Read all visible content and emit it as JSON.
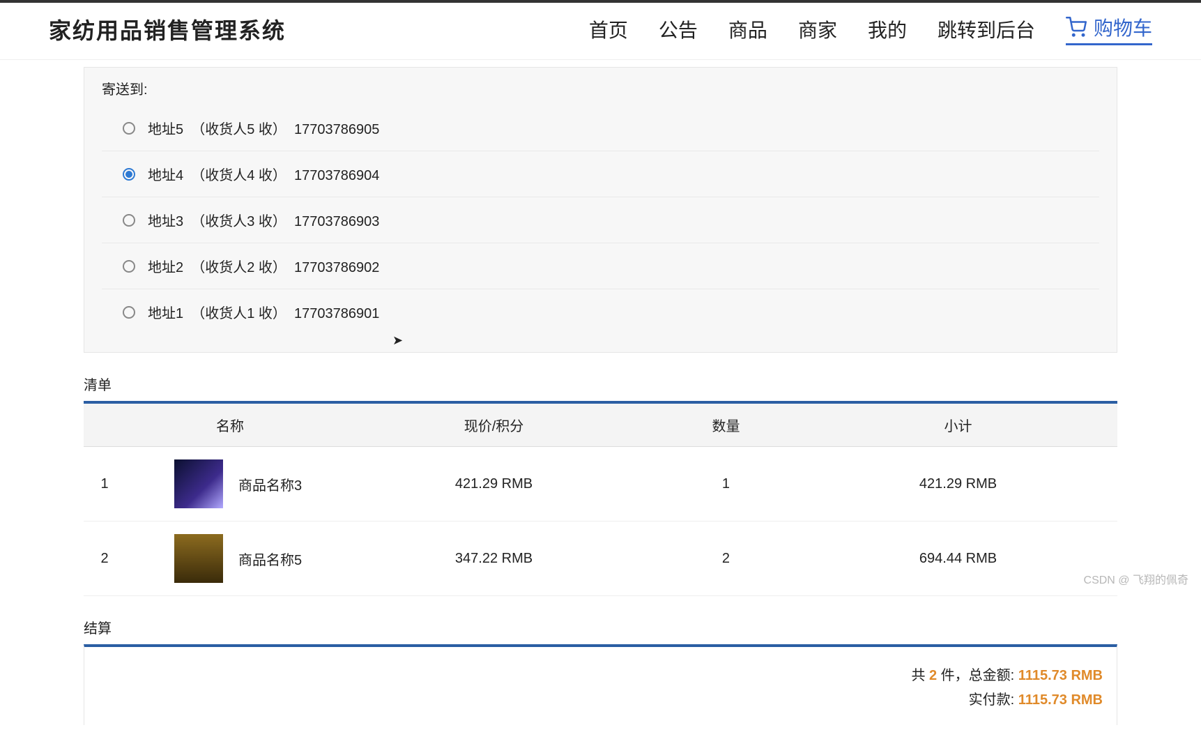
{
  "brand": "家纺用品销售管理系统",
  "nav": {
    "home": "首页",
    "notice": "公告",
    "goods": "商品",
    "merchant": "商家",
    "mine": "我的",
    "admin": "跳转到后台",
    "cart": "购物车"
  },
  "shipping": {
    "title": "寄送到:",
    "selected_index": 1,
    "addresses": [
      {
        "label": "地址5  （收货人5 收）  17703786905"
      },
      {
        "label": "地址4  （收货人4 收）  17703786904"
      },
      {
        "label": "地址3  （收货人3 收）  17703786903"
      },
      {
        "label": "地址2  （收货人2 收）  17703786902"
      },
      {
        "label": "地址1  （收货人1 收）  17703786901"
      }
    ]
  },
  "list": {
    "title": "清单",
    "headers": {
      "name": "名称",
      "price": "现价/积分",
      "qty": "数量",
      "subtotal": "小计"
    },
    "rows": [
      {
        "idx": "1",
        "name": "商品名称3",
        "price": "421.29 RMB",
        "qty": "1",
        "subtotal": "421.29 RMB"
      },
      {
        "idx": "2",
        "name": "商品名称5",
        "price": "347.22 RMB",
        "qty": "2",
        "subtotal": "694.44 RMB"
      }
    ]
  },
  "settle": {
    "title": "结算",
    "line1_prefix": "共 ",
    "count": "2",
    "line1_mid": " 件，总金额: ",
    "total": "1115.73 RMB",
    "line2_prefix": "实付款: ",
    "pay": "1115.73 RMB"
  },
  "watermark": "CSDN @ 飞翔的佩奇"
}
